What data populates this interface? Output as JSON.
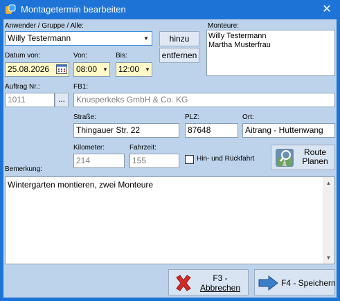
{
  "window": {
    "title": "Montagetermin bearbeiten"
  },
  "user_group": {
    "label": "Anwender / Gruppe / Alle:",
    "value": "Willy Testermann",
    "add_label": "hinzu",
    "remove_label": "entfernen"
  },
  "fitters": {
    "label": "Monteure:",
    "items": [
      "Willy Testermann",
      "Martha Musterfrau"
    ]
  },
  "date": {
    "label": "Datum von:",
    "value": "25.08.2026"
  },
  "time_from": {
    "label": "Von:",
    "value": "08:00"
  },
  "time_to": {
    "label": "Bis:",
    "value": "12:00"
  },
  "order": {
    "label": "Auftrag Nr.:",
    "value": "1011",
    "browse_label": "..."
  },
  "fb1": {
    "label": "FB1:",
    "value": "Knusperkeks GmbH & Co. KG"
  },
  "street": {
    "label": "Straße:",
    "value": "Thingauer Str. 22"
  },
  "zip": {
    "label": "PLZ:",
    "value": "87648"
  },
  "city": {
    "label": "Ort:",
    "value": "Aitrang - Huttenwang"
  },
  "distance": {
    "label": "Kilometer:",
    "value": "214"
  },
  "travel_time": {
    "label": "Fahrzeit:",
    "value": "155"
  },
  "round_trip": {
    "label": "Hin- und Rückfahrt",
    "checked": false
  },
  "route": {
    "line1": "Route",
    "line2": "Planen"
  },
  "remark": {
    "label": "Bemerkung:",
    "value": "Wintergarten montieren, zwei Monteure"
  },
  "actions": {
    "cancel_line1": "F3 -",
    "cancel_line2": "Abbrechen",
    "save_label": "F4 - Speichern"
  },
  "colors": {
    "title_bar": "#1e73d6",
    "client_bg": "#bcd3eb",
    "date_field_bg": "#fff9c8",
    "cancel_icon": "#d42a2a",
    "save_icon": "#3a7fc8"
  }
}
